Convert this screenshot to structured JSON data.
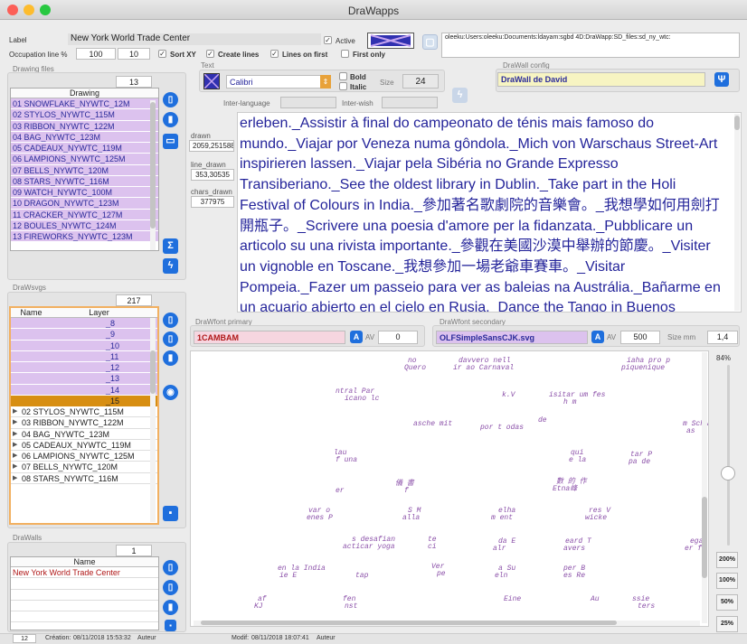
{
  "window": {
    "title": "DraWapps"
  },
  "label": {
    "caption": "Label",
    "value": "New York World Trade Center",
    "active": "Active"
  },
  "path": "oleeku:Users:oleeku:Documents:ldayam:sgbd 4D:DraWapp:SD_files:sd_ny_wtc:",
  "occ": {
    "caption": "Occupation line %",
    "v1": "100",
    "v2": "10",
    "sortxy": "Sort XY",
    "createlines": "Create lines",
    "linesfirst": "Lines on first",
    "firstonly": "First only"
  },
  "text": {
    "caption": "Text",
    "font": "Calibri",
    "bold": "Bold",
    "italic": "Italic",
    "size_label": "Size",
    "size": "24",
    "interlang": "Inter-language",
    "interwish": "Inter-wish"
  },
  "config": {
    "caption": "DraWall config",
    "value": "DraWall de David"
  },
  "files": {
    "caption": "Drawing files",
    "count": "13",
    "header": "Drawing",
    "items": [
      "01 SNOWFLAKE_NYWTC_12M",
      "02 STYLOS_NYWTC_115M",
      "03 RIBBON_NYWTC_122M",
      "04 BAG_NYWTC_123M",
      "05 CADEAUX_NYWTC_119M",
      "06 LAMPIONS_NYWTC_125M",
      "07 BELLS_NYWTC_120M",
      "08 STARS_NYWTC_116M",
      "09 WATCH_NYWTC_100M",
      "10 DRAGON_NYWTC_123M",
      "11 CRACKER_NYWTC_127M",
      "12 BOULES_NYWTC_124M",
      "13 FIREWORKS_NYWTC_123M"
    ]
  },
  "stats": {
    "drawn_label": "drawn",
    "drawn": "2059,251588",
    "line_label": "line_drawn",
    "line": "353,30535",
    "chars_label": "chars_drawn",
    "chars": "377975"
  },
  "paragraph": "erleben._Assistir à final do campeonato de ténis mais famoso do mundo._Viajar por Veneza numa gôndola._Mich von Warschaus Street-Art inspirieren lassen._Viajar pela Sibéria no Grande Expresso Transiberiano._See the oldest library in Dublin._Take part in the Holi Festival of Colours in India._參加著名歌劇院的音樂會。_我想學如何用劍打開瓶子。_Scrivere una poesia d'amore per la fidanzata._Pubblicare un articolo su una rivista importante._參觀在美國沙漠中舉辦的節慶。_Visiter un vignoble en Toscane._我想參加一場老爺車賽車。_Visitar Pompeia._Fazer um passeio para ver as baleias na Austrália._Bañarme en un acuario abierto en el cielo en Rusia._Dance the Tango in Buenos",
  "svgs": {
    "caption": "DraWsvgs",
    "count": "217",
    "h_name": "Name",
    "h_layer": "Layer",
    "layers": [
      "_8",
      "_9",
      "_10",
      "_11",
      "_12",
      "_13",
      "_14",
      "_15"
    ],
    "tree": [
      "02 STYLOS_NYWTC_115M",
      "03 RIBBON_NYWTC_122M",
      "04 BAG_NYWTC_123M",
      "05 CADEAUX_NYWTC_119M",
      "06 LAMPIONS_NYWTC_125M",
      "07 BELLS_NYWTC_120M",
      "08 STARS_NYWTC_116M"
    ]
  },
  "walls": {
    "caption": "DraWalls",
    "count": "1",
    "header": "Name",
    "items": [
      "New York World Trade Center"
    ]
  },
  "fontp": {
    "caption": "DraWfont primary",
    "value": "1CAMBAM",
    "av": "AV",
    "num": "0"
  },
  "fonts": {
    "caption": "DraWfont secondary",
    "value": "OLFSimpleSansCJK.svg",
    "av": "AV",
    "num": "500",
    "sizemm_label": "Size mm",
    "sizemm": "1,4"
  },
  "zoom": {
    "pct": "84%",
    "btns": [
      "200%",
      "100%",
      "50%",
      "25%"
    ],
    "level": 0.4
  },
  "canvas_words": [
    "no",
    "Quero",
    "davvero nell",
    "ir ao Carnaval",
    "iaha pro p",
    "piquenique",
    "ntral Par",
    "icano lc",
    "k.V",
    "isitar um fes",
    "h m",
    "asche mit",
    "de",
    "por t odas",
    "m Schw",
    "as",
    "lau",
    "f una",
    "qui",
    "e la",
    "tar P",
    "pa de",
    "儀 書",
    "er",
    "f",
    "數 的 作",
    "Etna峰",
    "var o",
    "enes P",
    "S M",
    "alla",
    "elha",
    "m ent",
    "res V",
    "wicke",
    "s desafian",
    "acticar yoga",
    "te",
    "ci",
    "da E",
    "alr",
    "eard T",
    "avers",
    "egar",
    "er fa r",
    "en la India",
    "ie E",
    "tap",
    "Ver",
    "pe",
    "a Su",
    "eln",
    "per B",
    "es Re",
    "af",
    "KJ",
    "fen",
    "nst",
    "Eine",
    "Au",
    "ssie",
    "ters"
  ],
  "status": {
    "num": "12",
    "created_label": "Création:",
    "created": "08/11/2018 15:53:32",
    "author1": "Auteur",
    "modif_label": "Modif:",
    "modif": "08/11/2018 18:07:41",
    "author2": "Auteur"
  },
  "colors": {
    "accent": "#1f6fdd",
    "purple": "#dcc2ee",
    "selected": "#d78e12",
    "text_blue": "#24249a"
  }
}
